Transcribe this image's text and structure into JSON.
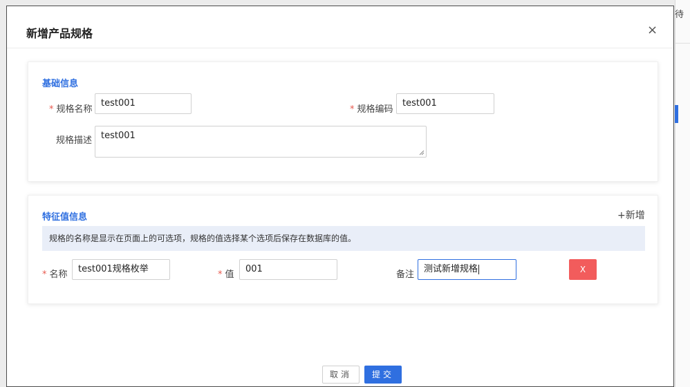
{
  "dialog": {
    "title": "新增产品规格",
    "close_label": "×"
  },
  "basic_info": {
    "section_title": "基础信息",
    "spec_name": {
      "label": "规格名称",
      "required_mark": "*",
      "value": "test001"
    },
    "spec_code": {
      "label": "规格编码",
      "required_mark": "*",
      "value": "test001"
    },
    "spec_desc": {
      "label": "规格描述",
      "value": "test001"
    }
  },
  "feature_info": {
    "section_title": "特征值信息",
    "add_label": "+新增",
    "hint": "规格的名称是显示在页面上的可选项，规格的值选择某个选项后保存在数据库的值。",
    "row": {
      "name": {
        "label": "名称",
        "required_mark": "*",
        "value": "test001规格枚举"
      },
      "value": {
        "label": "值",
        "required_mark": "*",
        "value": "001"
      },
      "remark": {
        "label": "备注",
        "value": "测试新增规格"
      },
      "delete_label": "X"
    }
  },
  "footer": {
    "cancel_label": "取消",
    "submit_label": "提交"
  },
  "background": {
    "edge_char": "待"
  },
  "colors": {
    "accent": "#2f6fe0",
    "danger": "#f25c5c",
    "required": "#e85a4f",
    "hint_bg": "#e9eef8"
  }
}
